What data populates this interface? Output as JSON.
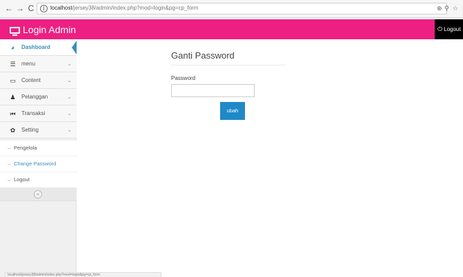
{
  "browser": {
    "back_icon": "←",
    "forward_icon": "→",
    "reload_icon": "C",
    "info_icon": "i",
    "url_host": "localhost",
    "url_path": "/jersey38/admin/index.php?mod=login&pg=cp_form",
    "zoom_icon": "⊕",
    "pin_icon": "⚲",
    "star_icon": "☆"
  },
  "header": {
    "brand": "Login Admin",
    "logout_icon": "⏻",
    "logout_label": "Logout",
    "color": "#ed1f82"
  },
  "sidebar": {
    "items": [
      {
        "label": "Dashboard",
        "icon": "dashboard-icon",
        "glyph": "◕",
        "active": true
      },
      {
        "label": "menu",
        "icon": "list-icon",
        "glyph": "☰"
      },
      {
        "label": "Content",
        "icon": "desktop-icon",
        "glyph": "▭"
      },
      {
        "label": "Pelanggan",
        "icon": "user-icon",
        "glyph": "♟"
      },
      {
        "label": "Transaksi",
        "icon": "step-backward-icon",
        "glyph": "⏮"
      },
      {
        "label": "Setting",
        "icon": "gear-icon",
        "glyph": "✿"
      }
    ],
    "chevron": "⌄",
    "submenu": [
      {
        "label": "Pengelola"
      },
      {
        "label": "Change Password",
        "current": true
      },
      {
        "label": "Logout"
      }
    ],
    "collapse_icon": "«"
  },
  "main": {
    "title": "Ganti Password",
    "password_label": "Password",
    "password_value": "",
    "submit_label": "ubah",
    "accent": "#1f8ac8"
  },
  "status_bar": {
    "text": "localhost/jersey38/admin/index.php?mod=login&pg=cp_form"
  }
}
